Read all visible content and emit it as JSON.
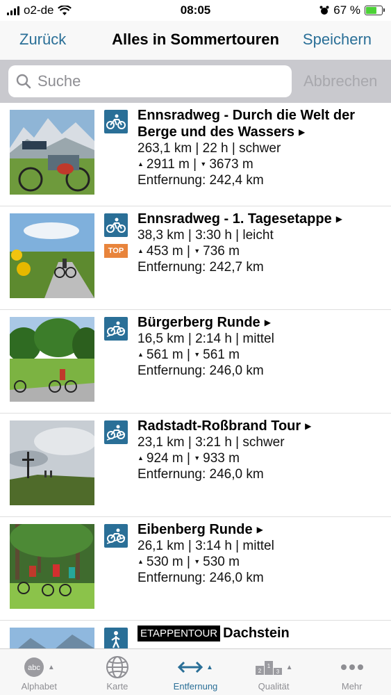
{
  "status_bar": {
    "carrier": "o2-de",
    "time": "08:05",
    "battery_percent": "67 %",
    "battery_level": 0.67
  },
  "nav": {
    "back_label": "Zurück",
    "title": "Alles in Sommertouren",
    "save_label": "Speichern"
  },
  "search": {
    "placeholder": "Suche",
    "value": "",
    "cancel_label": "Abbrechen"
  },
  "colors": {
    "accent": "#2a6f97",
    "top_badge": "#e8843c"
  },
  "tours": [
    {
      "title": "Ennsradweg - Durch die Welt der Berge und des Wassers",
      "stats": "263,1 km | 22 h | schwer",
      "ascent": "2911 m",
      "descent": "3673 m",
      "distance": "Entfernung: 242,4 km",
      "type_icon": "bike-icon"
    },
    {
      "title": "Ennsradweg - 1. Tagesetappe",
      "stats": "38,3 km | 3:30 h | leicht",
      "ascent": "453 m",
      "descent": "736 m",
      "distance": "Entfernung: 242,7 km",
      "type_icon": "bike-icon",
      "badge": "TOP"
    },
    {
      "title": "Bürgerberg Runde",
      "stats": "16,5 km | 2:14 h | mittel",
      "ascent": "561 m",
      "descent": "561 m",
      "distance": "Entfernung: 246,0 km",
      "type_icon": "mountain-bike-icon"
    },
    {
      "title": "Radstadt-Roßbrand Tour",
      "stats": "23,1 km | 3:21 h | schwer",
      "ascent": "924 m",
      "descent": "933 m",
      "distance": "Entfernung: 246,0 km",
      "type_icon": "mountain-bike-icon"
    },
    {
      "title": "Eibenberg Runde",
      "stats": "26,1 km | 3:14 h | mittel",
      "ascent": "530 m",
      "descent": "530 m",
      "distance": "Entfernung: 246,0 km",
      "type_icon": "mountain-bike-icon"
    },
    {
      "badge_label": "ETAPPENTOUR",
      "title": "Dachstein",
      "type_icon": "hiking-icon"
    }
  ],
  "tabs": [
    {
      "label": "Alphabet",
      "icon": "abc-icon"
    },
    {
      "label": "Karte",
      "icon": "globe-icon"
    },
    {
      "label": "Entfernung",
      "icon": "distance-icon",
      "active": true
    },
    {
      "label": "Qualität",
      "icon": "podium-icon"
    },
    {
      "label": "Mehr",
      "icon": "more-icon"
    }
  ]
}
